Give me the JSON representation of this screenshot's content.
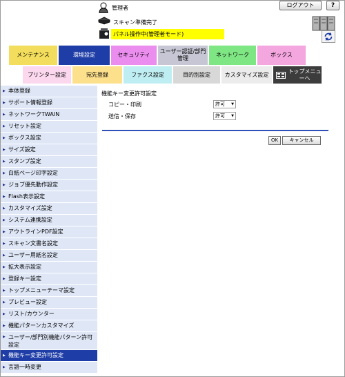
{
  "header": {
    "user_label": "管理者",
    "logout_label": "ログアウト",
    "help_label": "?",
    "scan_status": "スキャン準備完了",
    "panel_status": "パネル操作中(管理者モード)"
  },
  "tabs_main": [
    {
      "label": "メンテナンス"
    },
    {
      "label": "環境設定"
    },
    {
      "label": "セキュリティ"
    },
    {
      "label": "ユーザー認証/部門管理"
    },
    {
      "label": "ネットワーク"
    },
    {
      "label": "ボックス"
    }
  ],
  "tabs_sub": [
    {
      "label": "プリンター設定"
    },
    {
      "label": "宛先登録"
    },
    {
      "label": "ファクス設定"
    },
    {
      "label": "目的別設定"
    },
    {
      "label": "カスタマイズ設定"
    },
    {
      "label": "トップメニューへ"
    }
  ],
  "sidebar": {
    "items": [
      {
        "label": "本体登録"
      },
      {
        "label": "サポート情報登録"
      },
      {
        "label": "ネットワークTWAIN"
      },
      {
        "label": "リセット設定"
      },
      {
        "label": "ボックス設定"
      },
      {
        "label": "サイズ設定"
      },
      {
        "label": "スタンプ設定"
      },
      {
        "label": "白紙ページ印字設定"
      },
      {
        "label": "ジョブ優先動作設定"
      },
      {
        "label": "Flash表示設定"
      },
      {
        "label": "カスタマイズ設定"
      },
      {
        "label": "システム連携設定"
      },
      {
        "label": "アウトラインPDF設定"
      },
      {
        "label": "スキャン文書名設定"
      },
      {
        "label": "ユーザー用紙名設定"
      },
      {
        "label": "拡大表示設定"
      },
      {
        "label": "登録キー設定"
      },
      {
        "label": "トップメニューテーマ設定"
      },
      {
        "label": "プレビュー設定"
      },
      {
        "label": "リスト/カウンター"
      },
      {
        "label": "機能パターンカスタマイズ"
      },
      {
        "label": "ユーザー/部門別機能パターン許可設定"
      },
      {
        "label": "機能キー変更許可設定"
      },
      {
        "label": "言語一時変更"
      }
    ]
  },
  "main": {
    "title": "機能キー変更許可設定",
    "rows": [
      {
        "label": "コピー・印刷",
        "value": "許可"
      },
      {
        "label": "送信・保存",
        "value": "許可"
      }
    ],
    "ok_label": "OK",
    "cancel_label": "キャンセル"
  },
  "colors": {
    "accent": "#1f3da7",
    "panel_status_bg": "#ffff00",
    "sidebar_bg": "#dfe7f7"
  },
  "icons": [
    "user-icon",
    "scanner-icon",
    "panel-icon",
    "server-rack-icon",
    "refresh-icon",
    "top-menu-icon",
    "arrow-icon"
  ]
}
